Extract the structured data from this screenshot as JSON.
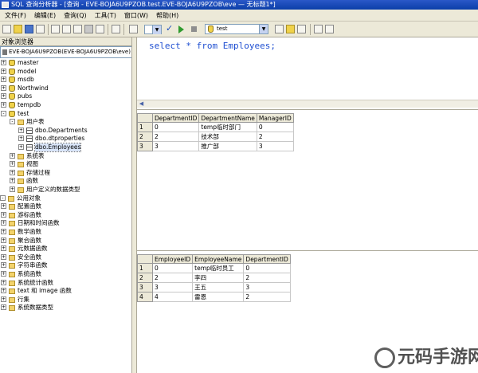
{
  "window": {
    "title": "SQL 查询分析器 - [查询 - EVE-BOJA6U9PZOB.test.EVE-BOJA6U9PZOB\\eve — 无标题1*]"
  },
  "menu": [
    "文件(F)",
    "编辑(E)",
    "查询(Q)",
    "工具(T)",
    "窗口(W)",
    "帮助(H)"
  ],
  "toolbar": {
    "database": "test"
  },
  "object_browser": {
    "header": "对象浏览器",
    "server": "EVE-BOJA6U9PZOB(EVE-BOJA6U9PZOB\\eve)",
    "tree": [
      {
        "label": "master",
        "icon": "database-icon",
        "depth": 0,
        "exp": "+"
      },
      {
        "label": "model",
        "icon": "database-icon",
        "depth": 0,
        "exp": "+"
      },
      {
        "label": "msdb",
        "icon": "database-icon",
        "depth": 0,
        "exp": "+"
      },
      {
        "label": "Northwind",
        "icon": "database-icon",
        "depth": 0,
        "exp": "+"
      },
      {
        "label": "pubs",
        "icon": "database-icon",
        "depth": 0,
        "exp": "+"
      },
      {
        "label": "tempdb",
        "icon": "database-icon",
        "depth": 0,
        "exp": "+"
      },
      {
        "label": "test",
        "icon": "database-icon",
        "depth": 0,
        "exp": "-"
      },
      {
        "label": "用户表",
        "icon": "folder-icon",
        "depth": 1,
        "exp": "-"
      },
      {
        "label": "dbo.Departments",
        "icon": "table-icon",
        "depth": 2,
        "exp": "+"
      },
      {
        "label": "dbo.dtproperties",
        "icon": "table-icon",
        "depth": 2,
        "exp": "+"
      },
      {
        "label": "dbo.Employees",
        "icon": "table-icon",
        "depth": 2,
        "exp": "+",
        "selected": true
      },
      {
        "label": "系统表",
        "icon": "folder-icon",
        "depth": 1,
        "exp": "+"
      },
      {
        "label": "视图",
        "icon": "folder-icon",
        "depth": 1,
        "exp": "+"
      },
      {
        "label": "存储过程",
        "icon": "folder-icon",
        "depth": 1,
        "exp": "+"
      },
      {
        "label": "函数",
        "icon": "folder-icon",
        "depth": 1,
        "exp": "+"
      },
      {
        "label": "用户定义的数据类型",
        "icon": "folder-icon",
        "depth": 1,
        "exp": "+"
      },
      {
        "label": "公用对象",
        "icon": "folder-icon",
        "depth": -1,
        "exp": "-"
      },
      {
        "label": "配置函数",
        "icon": "folder-icon",
        "depth": 0,
        "exp": "+"
      },
      {
        "label": "游标函数",
        "icon": "folder-icon",
        "depth": 0,
        "exp": "+"
      },
      {
        "label": "日期和时间函数",
        "icon": "folder-icon",
        "depth": 0,
        "exp": "+"
      },
      {
        "label": "数学函数",
        "icon": "folder-icon",
        "depth": 0,
        "exp": "+"
      },
      {
        "label": "聚合函数",
        "icon": "folder-icon",
        "depth": 0,
        "exp": "+"
      },
      {
        "label": "元数据函数",
        "icon": "folder-icon",
        "depth": 0,
        "exp": "+"
      },
      {
        "label": "安全函数",
        "icon": "folder-icon",
        "depth": 0,
        "exp": "+"
      },
      {
        "label": "字符串函数",
        "icon": "folder-icon",
        "depth": 0,
        "exp": "+"
      },
      {
        "label": "系统函数",
        "icon": "folder-icon",
        "depth": 0,
        "exp": "+"
      },
      {
        "label": "系统统计函数",
        "icon": "folder-icon",
        "depth": 0,
        "exp": "+"
      },
      {
        "label": "text 和 image 函数",
        "icon": "folder-icon",
        "depth": 0,
        "exp": "+"
      },
      {
        "label": "行集",
        "icon": "folder-icon",
        "depth": 0,
        "exp": "+"
      },
      {
        "label": "系统数据类型",
        "icon": "folder-icon",
        "depth": 0,
        "exp": "+"
      }
    ]
  },
  "editor": {
    "keyword1": "select",
    "star": " * ",
    "keyword2": "from",
    "table": " Employees;"
  },
  "results": [
    {
      "columns": [
        "DepartmentID",
        "DepartmentName",
        "ManagerID"
      ],
      "rows": [
        [
          "1",
          "0",
          "temp临时部门",
          "0"
        ],
        [
          "2",
          "2",
          "技术部",
          "2"
        ],
        [
          "3",
          "3",
          "推广部",
          "3"
        ]
      ]
    },
    {
      "columns": [
        "EmployeeID",
        "EmployeeName",
        "DepartmentID"
      ],
      "rows": [
        [
          "1",
          "0",
          "temp临时员工",
          "0"
        ],
        [
          "2",
          "2",
          "李四",
          "2"
        ],
        [
          "3",
          "3",
          "王五",
          "3"
        ],
        [
          "4",
          "4",
          "雷恩",
          "2"
        ]
      ]
    }
  ],
  "watermark": "元码手游网"
}
